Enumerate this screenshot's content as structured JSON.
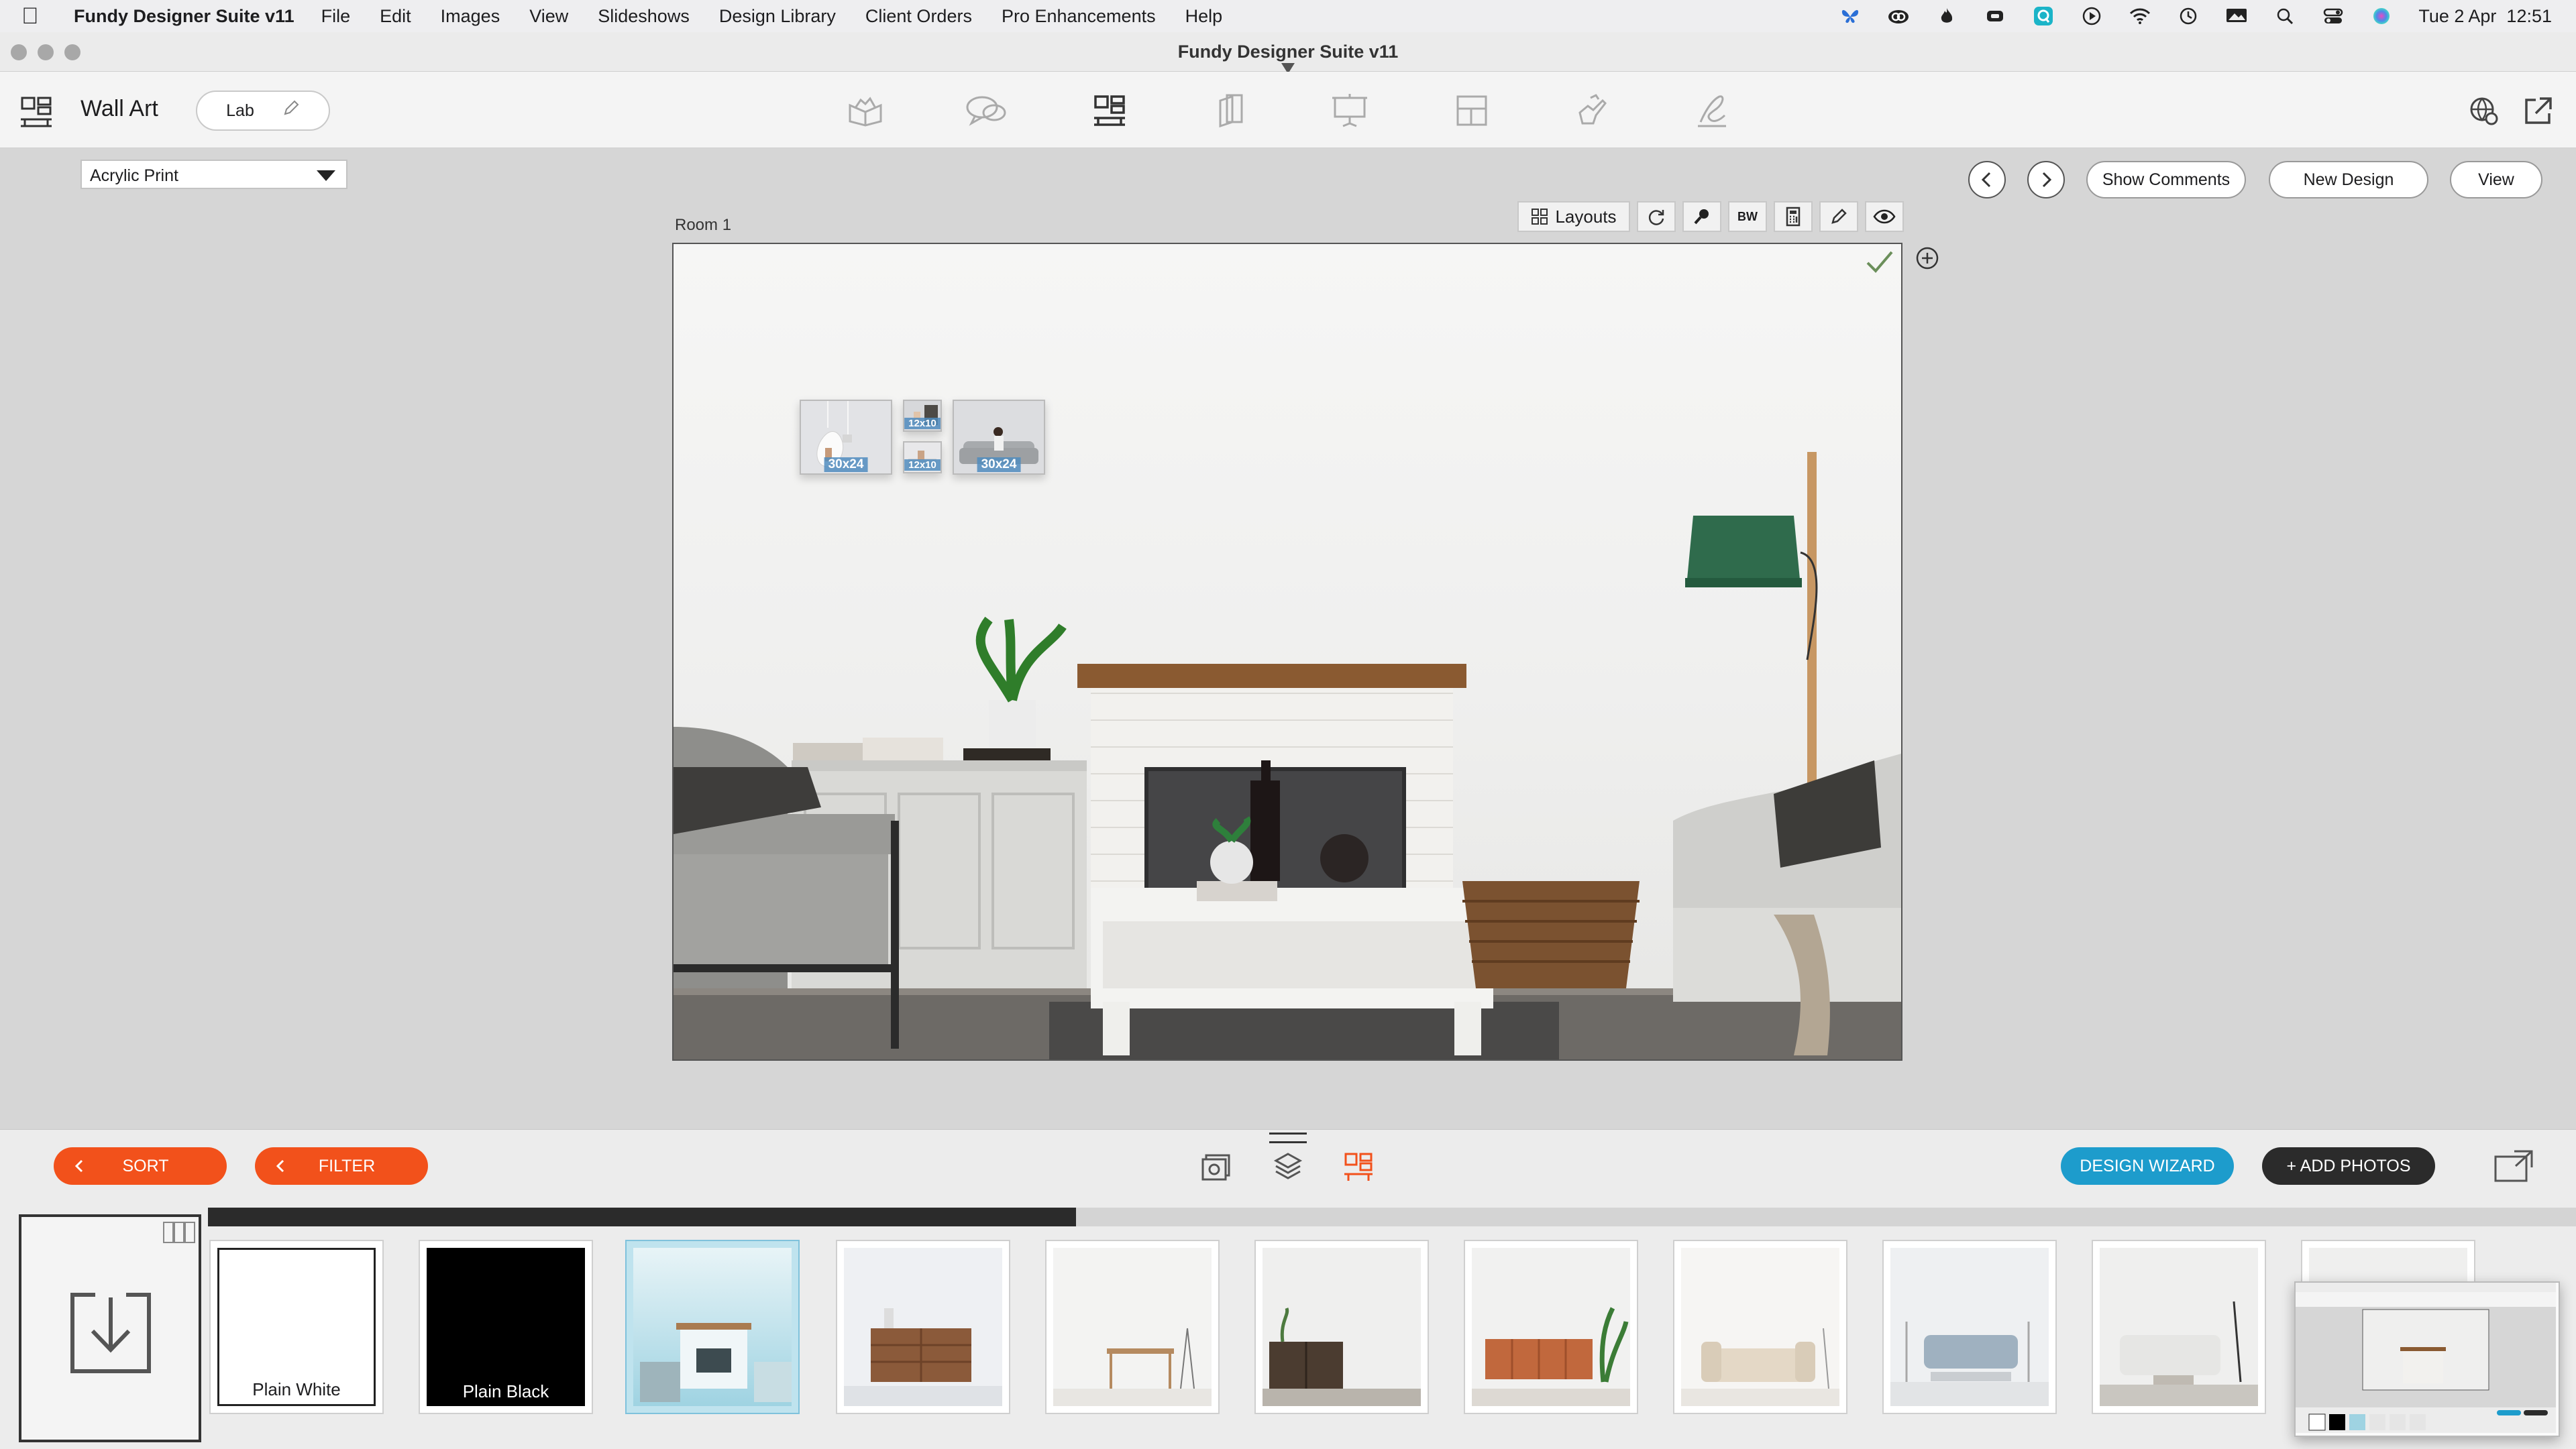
{
  "menubar": {
    "app_name": "Fundy Designer Suite v11",
    "menus": [
      "File",
      "Edit",
      "Images",
      "View",
      "Slideshows",
      "Design Library",
      "Client Orders",
      "Pro Enhancements",
      "Help"
    ],
    "clock": "Tue 2 Apr  12:51",
    "tray_icons": [
      "butterfly-icon",
      "creative-cloud-icon",
      "flame-icon",
      "cloud-app-icon",
      "app-q-icon",
      "play-icon",
      "wifi-icon",
      "time-machine-icon",
      "display-icon",
      "spotlight-icon",
      "control-center-icon",
      "siri-icon"
    ]
  },
  "window": {
    "title": "Fundy Designer Suite v11"
  },
  "toolbar": {
    "module_label": "Wall Art",
    "lab_label": "Lab",
    "tools": [
      "album-icon",
      "proof-speech-icon",
      "wall-art-icon",
      "cards-icon",
      "presentation-icon",
      "layout-icon",
      "hand-icon",
      "signature-icon"
    ]
  },
  "product": {
    "selected": "Acrylic Print"
  },
  "nav": {
    "show_comments": "Show Comments",
    "new_design": "New Design",
    "view": "View"
  },
  "canvas": {
    "room_label": "Room 1",
    "layouts_label": "Layouts",
    "bw_label": "BW",
    "frames": [
      {
        "size": "30x24"
      },
      {
        "size": "12x10"
      },
      {
        "size": "12x10"
      },
      {
        "size": "30x24"
      }
    ]
  },
  "bottom": {
    "sort_label": "SORT",
    "filter_label": "FILTER",
    "design_wizard_label": "DESIGN WIZARD",
    "add_photos_label": "+ ADD PHOTOS",
    "thumbs": [
      {
        "caption": "Plain White"
      },
      {
        "caption": "Plain Black"
      }
    ]
  }
}
